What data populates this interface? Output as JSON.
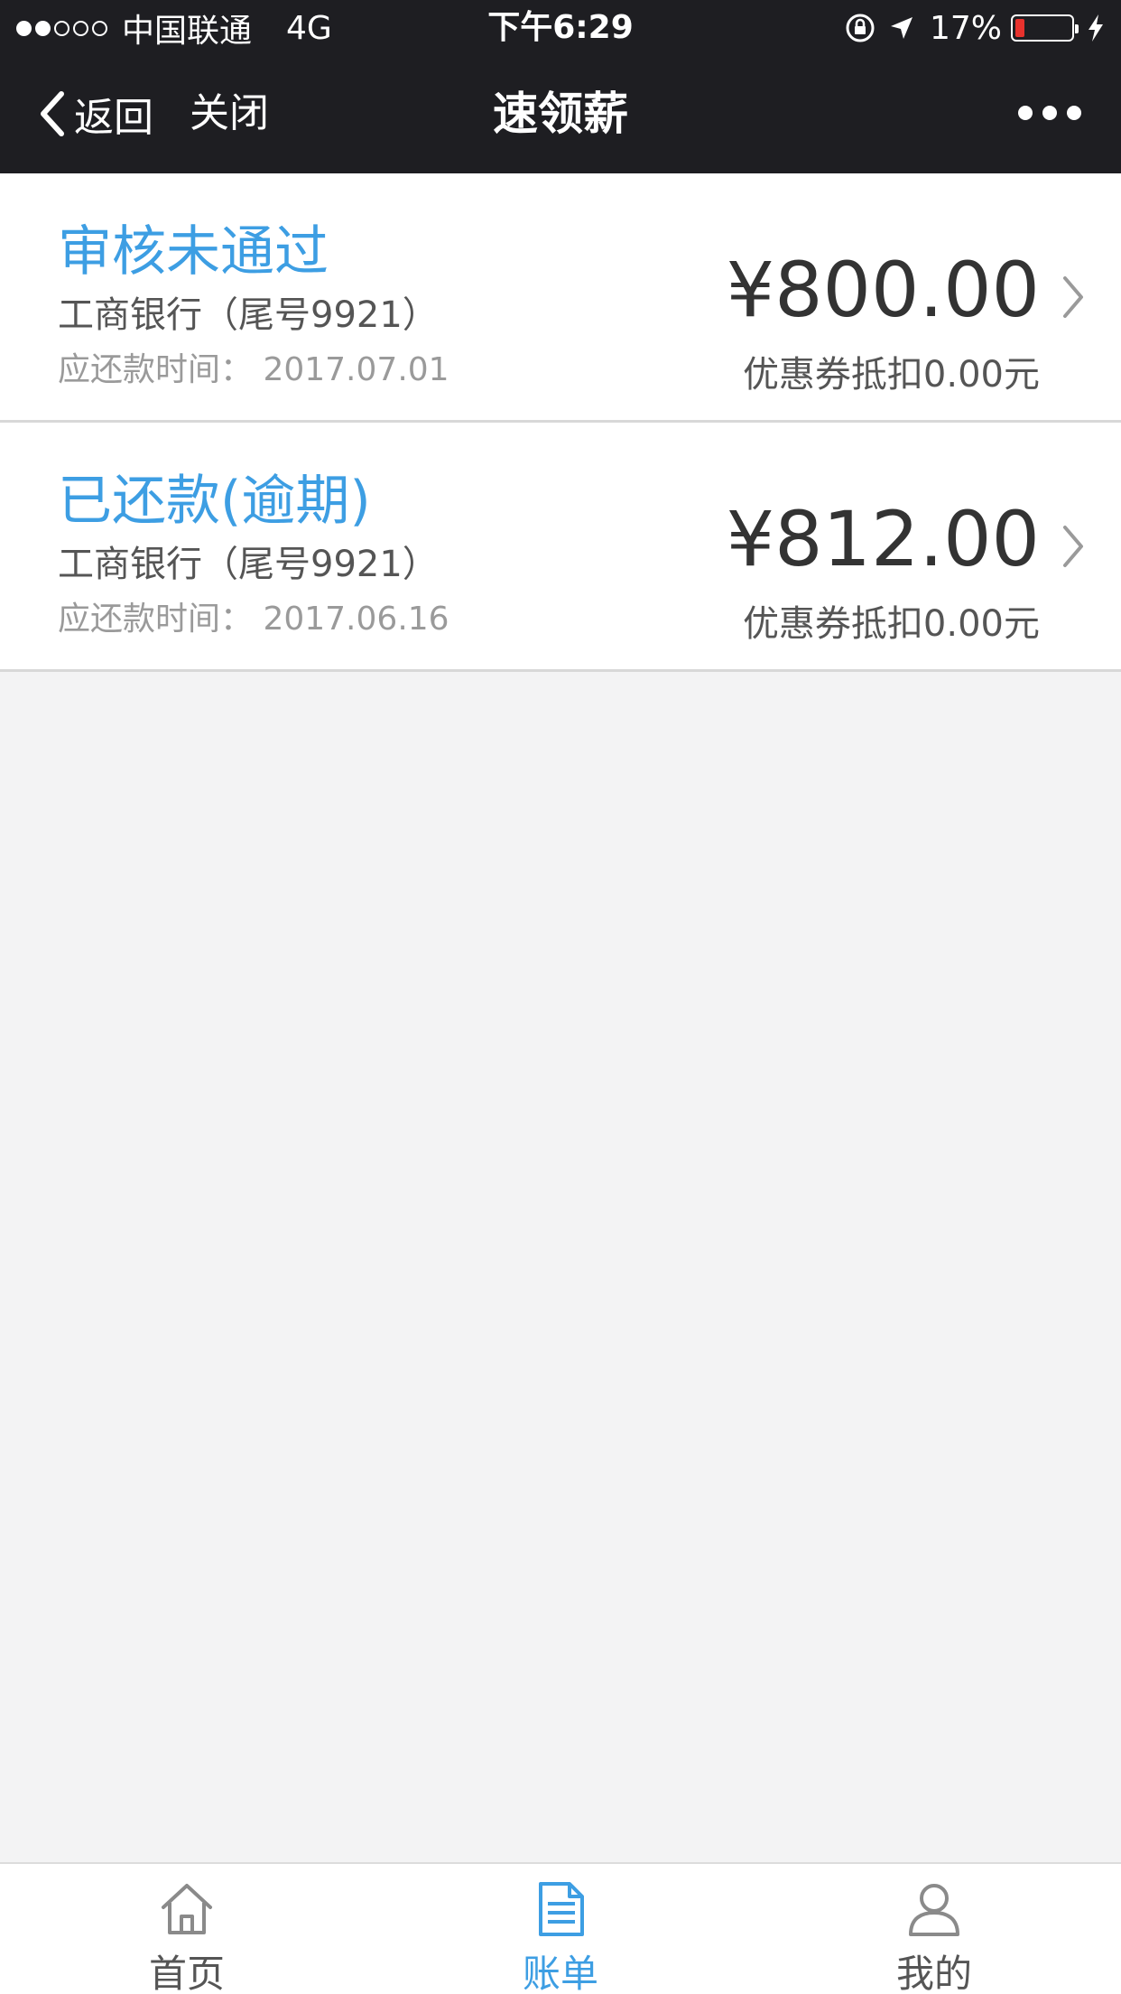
{
  "status_bar": {
    "carrier": "中国联通",
    "network": "4G",
    "time": "下午6:29",
    "battery": "17%",
    "battery_level": 0.17,
    "signal_bars": 2,
    "signal_total": 5,
    "icons": [
      "orientation-lock-icon",
      "location-arrow-icon",
      "battery-icon",
      "charging-bolt-icon"
    ]
  },
  "nav": {
    "back_label": "返回",
    "close_label": "关闭",
    "title": "速领薪",
    "more_icon": "more-dots-icon"
  },
  "bills": [
    {
      "status": "审核未通过",
      "bank": "工商银行（尾号9921）",
      "due": "应还款时间：  2017.07.01",
      "amount": "¥800.00",
      "coupon": "优惠券抵扣0.00元"
    },
    {
      "status": "已还款(逾期)",
      "bank": "工商银行（尾号9921）",
      "due": "应还款时间：  2017.06.16",
      "amount": "¥812.00",
      "coupon": "优惠券抵扣0.00元"
    }
  ],
  "tabbar": {
    "items": [
      {
        "label": "首页",
        "icon": "home-icon",
        "active": false
      },
      {
        "label": "账单",
        "icon": "bill-document-icon",
        "active": true
      },
      {
        "label": "我的",
        "icon": "user-profile-icon",
        "active": false
      }
    ]
  },
  "colors": {
    "accent": "#3d9ee3",
    "header_bg": "#1e1e22",
    "page_bg": "#f3f3f4",
    "battery_low": "#e8322d"
  }
}
